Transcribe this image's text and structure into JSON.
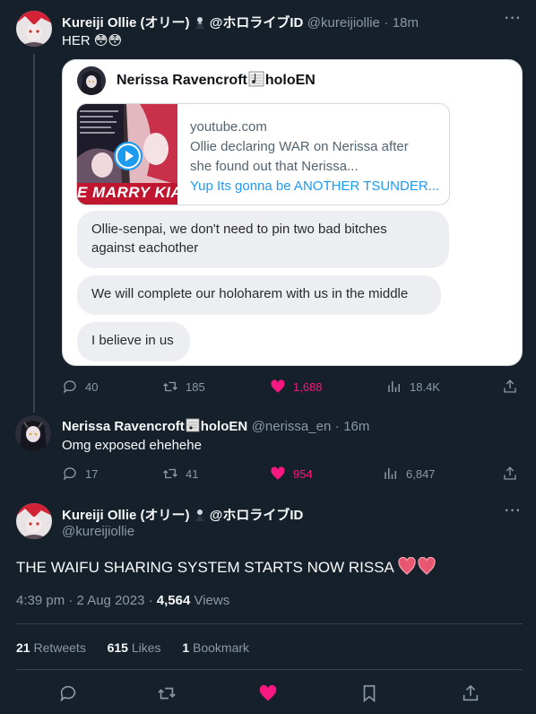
{
  "tweet1": {
    "name": "Kureiji Ollie (オリー) ",
    "org": "@ホロライブID",
    "handle": "@kureijiollie",
    "time": "18m",
    "text": "HER",
    "emoji": "😳😳",
    "quote": {
      "name": "Nerissa Ravencroft",
      "suffix": "holoEN",
      "link_domain": "youtube.com",
      "link_title_1": "Ollie declaring WAR on Nerissa after",
      "link_title_2": "she found out that Nerissa...",
      "link_desc": "Yup Its gonna be ANOTHER TSUNDER...",
      "thumb_caption": "E MARRY KIAR",
      "bubbles": [
        "Ollie-senpai, we don't need to pin two bad bitches",
        "against eachother",
        "We will complete our holoharem with us in the middle",
        "I believe in us"
      ]
    },
    "replies": "40",
    "retweets": "185",
    "likes": "1,688",
    "views": "18.4K"
  },
  "tweet2": {
    "name": "Nerissa Ravencroft",
    "suffix": "holoEN",
    "handle": "@nerissa_en",
    "time": "16m",
    "text": "Omg exposed ehehehe",
    "replies": "17",
    "retweets": "41",
    "likes": "954",
    "views": "6,847"
  },
  "tweet3": {
    "name": "Kureiji Ollie (オリー) ",
    "org": "@ホロライブID",
    "handle": "@kureijiollie",
    "text": "THE WAIFU SHARING SYSTEM STARTS NOW RISSA ",
    "time_date": "4:39 pm · 2 Aug 2023 · ",
    "views_count": "4,564",
    "views_label": " Views",
    "retweets_count": "21",
    "retweets_label": " Retweets",
    "likes_count": "615",
    "likes_label": " Likes",
    "bookmarks_count": "1",
    "bookmarks_label": " Bookmark"
  },
  "colors": {
    "background": "#15202b",
    "text": "#f7f9f9",
    "secondary": "#8b98a5",
    "like_pink": "#f91880",
    "divider": "#38444d",
    "link_blue": "#1d9bf0"
  }
}
